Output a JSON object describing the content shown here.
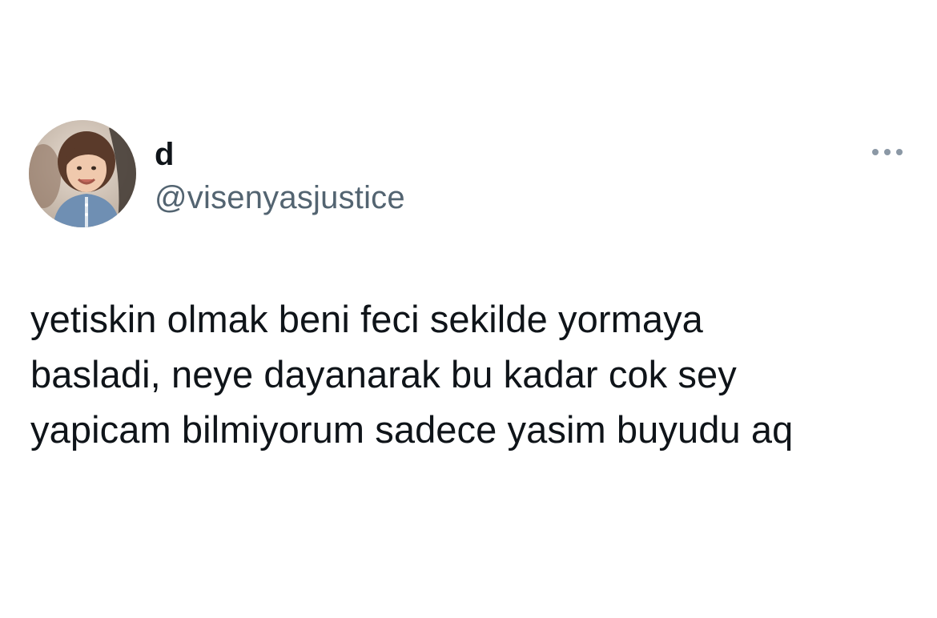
{
  "tweet": {
    "author": {
      "display_name": "d",
      "handle": "@visenyasjustice",
      "avatar_icon": "avatar-photo"
    },
    "more_icon": "more-options-icon",
    "text": "yetiskin olmak beni feci sekilde yormaya\nbasladi, neye dayanarak bu kadar cok sey\nyapicam bilmiyorum sadece yasim buyudu aq"
  },
  "colors": {
    "background": "#ffffff",
    "primary_text": "#0f1419",
    "secondary_text": "#536471",
    "icon_gray": "#8b98a5"
  }
}
